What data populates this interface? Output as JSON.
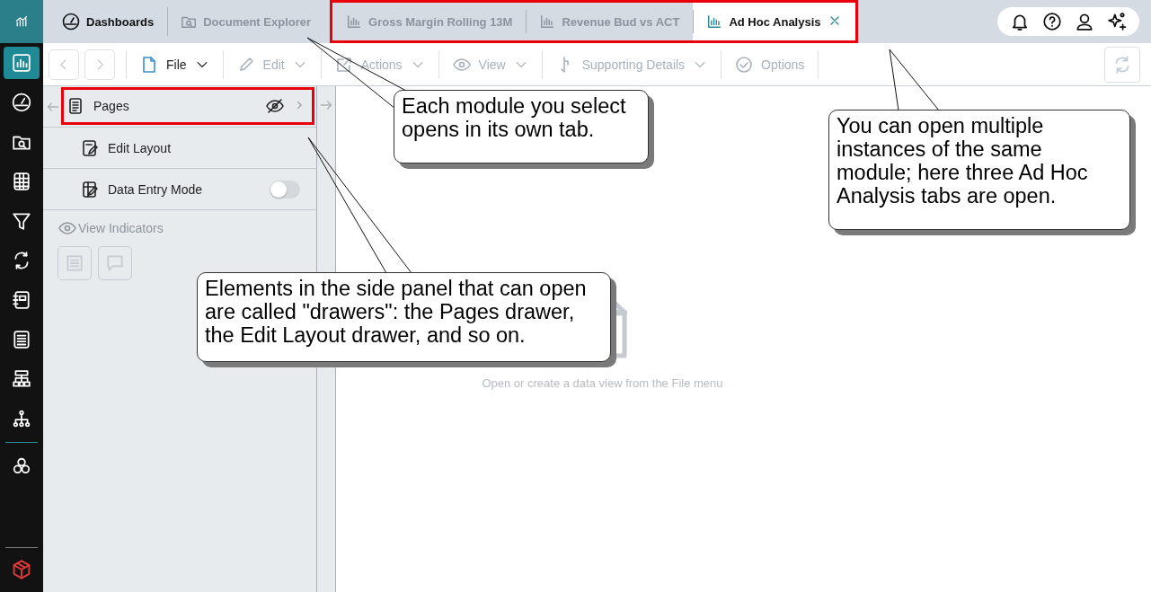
{
  "rail": [
    {
      "selected": true
    },
    {
      "selected": false
    },
    {
      "selected": false
    },
    {
      "selected": false
    },
    {
      "selected": false
    },
    {
      "selected": false
    },
    {
      "selected": false
    },
    {
      "selected": false
    },
    {
      "selected": false
    },
    {
      "selected": false
    },
    {
      "selected": false
    }
  ],
  "tab_groups": [
    {
      "highlighted": false,
      "tabs": [
        {
          "kind": "home",
          "label": "Dashboards",
          "selected": false
        },
        {
          "kind": "explorer",
          "label": "Document Explorer",
          "selected": false
        }
      ]
    },
    {
      "highlighted": true,
      "tabs": [
        {
          "kind": "analysis",
          "label": "Gross Margin Rolling 13M",
          "selected": false
        },
        {
          "kind": "analysis",
          "label": "Revenue Bud vs ACT",
          "selected": false
        },
        {
          "kind": "analysis",
          "label": "Ad Hoc Analysis",
          "selected": true
        }
      ]
    }
  ],
  "toolbar": {
    "items": [
      {
        "kind": "file",
        "label": "File",
        "disabled": false
      },
      {
        "kind": "edit",
        "label": "Edit",
        "disabled": true
      },
      {
        "kind": "actions",
        "label": "Actions",
        "disabled": true
      },
      {
        "kind": "view",
        "label": "View",
        "disabled": true
      },
      {
        "kind": "details",
        "label": "Supporting Details",
        "disabled": true
      },
      {
        "kind": "options",
        "label": "Options",
        "disabled": true
      }
    ]
  },
  "drawers": [
    {
      "kind": "pages",
      "label": "Pages",
      "highlighted": true
    },
    {
      "kind": "layout",
      "label": "Edit Layout",
      "highlighted": false
    },
    {
      "kind": "toggle",
      "label": "Data Entry Mode",
      "highlighted": false,
      "on": false
    }
  ],
  "indicators": {
    "label": "View Indicators",
    "disabled": true
  },
  "empty_state": {
    "message": "Open or create a data view from the File menu"
  },
  "callouts": [
    {
      "text": "Each module you select opens in its own tab."
    },
    {
      "text": "You can open multiple instances of the same module; here three Ad Hoc Analysis tabs are open."
    },
    {
      "text": "Elements in the side panel that can open are called \"drawers\": the Pages drawer, the Edit Layout drawer, and so on."
    }
  ]
}
